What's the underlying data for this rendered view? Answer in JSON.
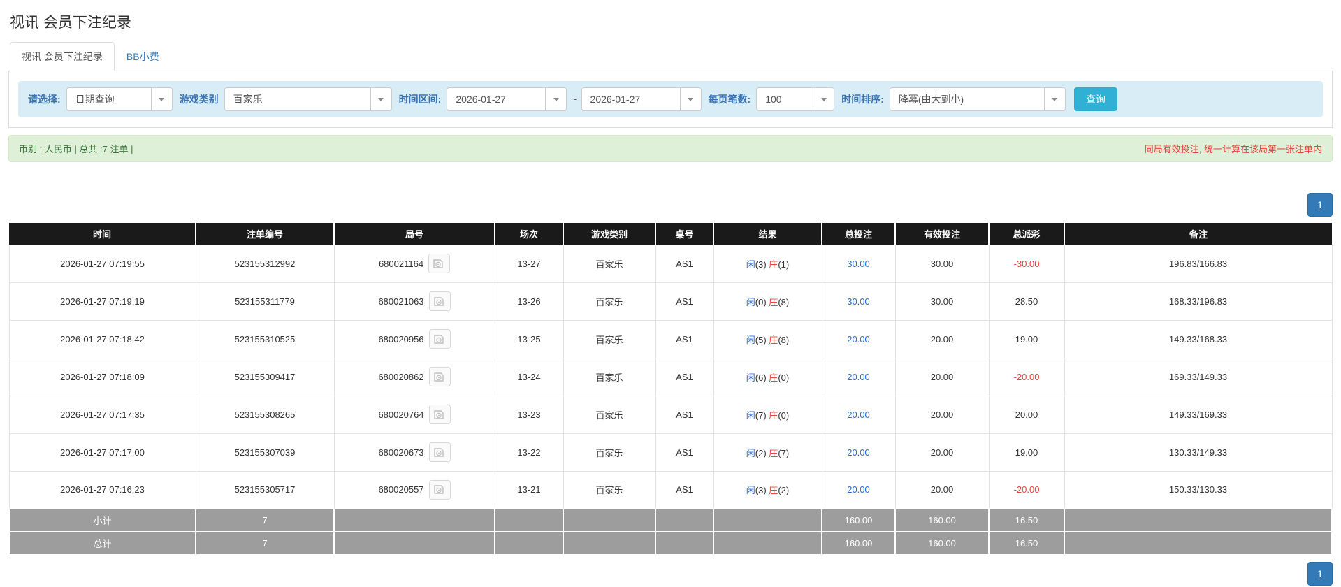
{
  "page": {
    "title": "视讯 会员下注纪录"
  },
  "tabs": [
    {
      "label": "视讯 会员下注纪录",
      "active": true
    },
    {
      "label": "BB小费",
      "active": false
    }
  ],
  "filters": {
    "select_label": "请选择:",
    "select_value": "日期查询",
    "game_type_label": "游戏类别",
    "game_type_value": "百家乐",
    "date_range_label": "时间区间:",
    "date_from": "2026-01-27",
    "tilde": "~",
    "date_to": "2026-01-27",
    "page_size_label": "每页笔数:",
    "page_size_value": "100",
    "sort_label": "时间排序:",
    "sort_value": "降冪(由大到小)",
    "query_button": "查询"
  },
  "summary": {
    "left": "币别 : 人民币 | 总共 :7 注单 |",
    "right": "同局有效投注, 统一计算在该局第一张注单内"
  },
  "pagination": {
    "page": "1"
  },
  "table": {
    "headers": [
      "时间",
      "注单编号",
      "局号",
      "场次",
      "游戏类别",
      "桌号",
      "结果",
      "总投注",
      "有效投注",
      "总派彩",
      "备注"
    ],
    "rows": [
      {
        "time": "2026-01-27 07:19:55",
        "bet_no": "523155312992",
        "round_no": "680021164",
        "session": "13-27",
        "game": "百家乐",
        "table_no": "AS1",
        "player": "闲",
        "player_score": "(3)",
        "banker": "庄",
        "banker_score": "(1)",
        "total_bet": "30.00",
        "valid_bet": "30.00",
        "payout": "-30.00",
        "remark": "196.83/166.83"
      },
      {
        "time": "2026-01-27 07:19:19",
        "bet_no": "523155311779",
        "round_no": "680021063",
        "session": "13-26",
        "game": "百家乐",
        "table_no": "AS1",
        "player": "闲",
        "player_score": "(0)",
        "banker": "庄",
        "banker_score": "(8)",
        "total_bet": "30.00",
        "valid_bet": "30.00",
        "payout": "28.50",
        "remark": "168.33/196.83"
      },
      {
        "time": "2026-01-27 07:18:42",
        "bet_no": "523155310525",
        "round_no": "680020956",
        "session": "13-25",
        "game": "百家乐",
        "table_no": "AS1",
        "player": "闲",
        "player_score": "(5)",
        "banker": "庄",
        "banker_score": "(8)",
        "total_bet": "20.00",
        "valid_bet": "20.00",
        "payout": "19.00",
        "remark": "149.33/168.33"
      },
      {
        "time": "2026-01-27 07:18:09",
        "bet_no": "523155309417",
        "round_no": "680020862",
        "session": "13-24",
        "game": "百家乐",
        "table_no": "AS1",
        "player": "闲",
        "player_score": "(6)",
        "banker": "庄",
        "banker_score": "(0)",
        "total_bet": "20.00",
        "valid_bet": "20.00",
        "payout": "-20.00",
        "remark": "169.33/149.33"
      },
      {
        "time": "2026-01-27 07:17:35",
        "bet_no": "523155308265",
        "round_no": "680020764",
        "session": "13-23",
        "game": "百家乐",
        "table_no": "AS1",
        "player": "闲",
        "player_score": "(7)",
        "banker": "庄",
        "banker_score": "(0)",
        "total_bet": "20.00",
        "valid_bet": "20.00",
        "payout": "20.00",
        "remark": "149.33/169.33"
      },
      {
        "time": "2026-01-27 07:17:00",
        "bet_no": "523155307039",
        "round_no": "680020673",
        "session": "13-22",
        "game": "百家乐",
        "table_no": "AS1",
        "player": "闲",
        "player_score": "(2)",
        "banker": "庄",
        "banker_score": "(7)",
        "total_bet": "20.00",
        "valid_bet": "20.00",
        "payout": "19.00",
        "remark": "130.33/149.33"
      },
      {
        "time": "2026-01-27 07:16:23",
        "bet_no": "523155305717",
        "round_no": "680020557",
        "session": "13-21",
        "game": "百家乐",
        "table_no": "AS1",
        "player": "闲",
        "player_score": "(3)",
        "banker": "庄",
        "banker_score": "(2)",
        "total_bet": "20.00",
        "valid_bet": "20.00",
        "payout": "-20.00",
        "remark": "150.33/130.33"
      }
    ],
    "subtotal": {
      "label": "小计",
      "count": "7",
      "total_bet": "160.00",
      "valid_bet": "160.00",
      "payout": "16.50"
    },
    "total": {
      "label": "总计",
      "count": "7",
      "total_bet": "160.00",
      "valid_bet": "160.00",
      "payout": "16.50"
    }
  },
  "colors": {
    "accent_blue": "#337ab7",
    "data_blue": "#2b6cd4",
    "negative_red": "#e8413d",
    "filter_bar_bg": "#d9edf7",
    "filter_label": "#3a73b4",
    "query_button_bg": "#31b0d5",
    "summary_bg": "#dff0d8",
    "summary_text": "#3c763d",
    "table_header_bg": "#1a1a1a",
    "table_footer_bg": "#9d9d9d"
  }
}
